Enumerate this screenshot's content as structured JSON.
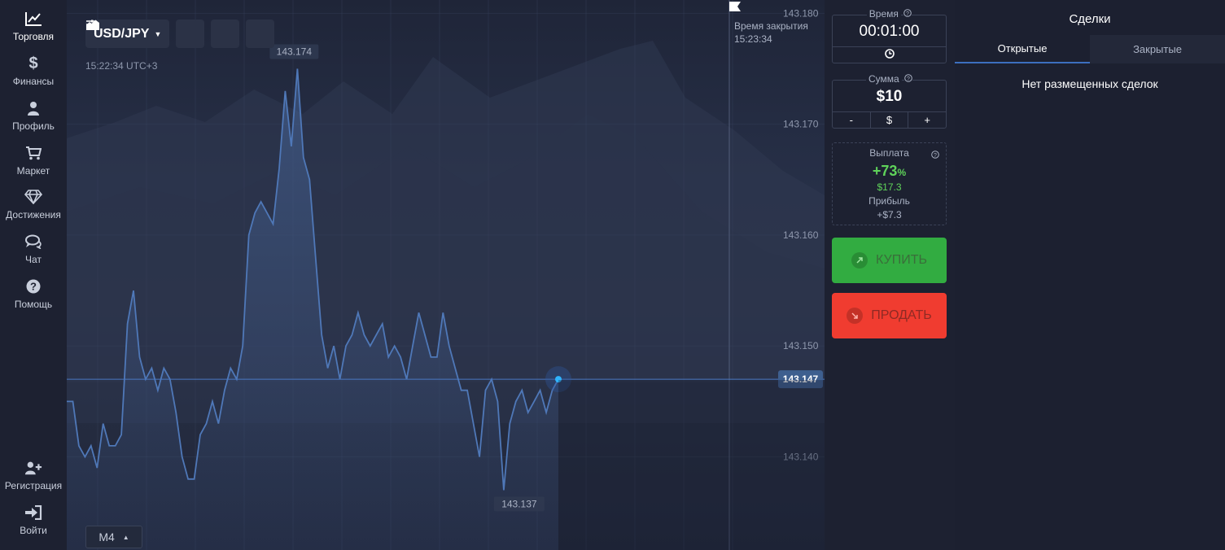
{
  "sidebar": {
    "items": [
      {
        "label": "Торговля",
        "icon": "chart-line-icon"
      },
      {
        "label": "Финансы",
        "icon": "dollar-icon"
      },
      {
        "label": "Профиль",
        "icon": "user-icon"
      },
      {
        "label": "Маркет",
        "icon": "cart-icon"
      },
      {
        "label": "Достижения",
        "icon": "diamond-icon"
      },
      {
        "label": "Чат",
        "icon": "chat-icon"
      },
      {
        "label": "Помощь",
        "icon": "help-icon"
      }
    ],
    "bottom": [
      {
        "label": "Регистрация",
        "icon": "add-user-icon"
      },
      {
        "label": "Войти",
        "icon": "sign-in-icon"
      }
    ]
  },
  "chart": {
    "pair": "USD/JPY",
    "clock": "15:22:34 UTC+3",
    "timeframe": "M4",
    "close_time_label": "Время закрытия",
    "close_time": "15:23:34",
    "max_label": "143.174",
    "min_label": "143.137",
    "current_price": "143.147",
    "line_color": "#4f78b8",
    "price_tag_color": "#3e5f8f"
  },
  "chart_data": {
    "type": "area",
    "series": [
      {
        "values": [
          143.145,
          143.145,
          143.141,
          143.14,
          143.141,
          143.139,
          143.143,
          143.141,
          143.141,
          143.142,
          143.152,
          143.155,
          143.149,
          143.147,
          143.148,
          143.146,
          143.148,
          143.147,
          143.144,
          143.14,
          143.138,
          143.138,
          143.142,
          143.143,
          143.145,
          143.143,
          143.146,
          143.148,
          143.147,
          143.15,
          143.16,
          143.162,
          143.163,
          143.162,
          143.161,
          143.166,
          143.173,
          143.168,
          143.175,
          143.167,
          143.165,
          143.158,
          143.151,
          143.148,
          143.15,
          143.147,
          143.15,
          143.151,
          143.153,
          143.151,
          143.15,
          143.151,
          143.152,
          143.149,
          143.15,
          143.149,
          143.147,
          143.15,
          143.153,
          143.151,
          143.149,
          143.149,
          143.153,
          143.15,
          143.148,
          143.146,
          143.146,
          143.143,
          143.14,
          143.146,
          143.147,
          143.145,
          143.137,
          143.143,
          143.145,
          143.146,
          143.144,
          143.145,
          143.146,
          143.144,
          143.146,
          143.147
        ]
      }
    ],
    "y_ticks": [
      "143.180",
      "143.170",
      "143.160",
      "143.150",
      "143.140"
    ],
    "ylim": [
      143.1316,
      143.1812
    ],
    "grid": true
  },
  "trade": {
    "time_label": "Время",
    "time_value": "00:01:00",
    "sum_label": "Сумма",
    "sum_value": "$10",
    "sum_buttons": [
      "-",
      "$",
      "+"
    ],
    "payout_label": "Выплата",
    "payout_percent": "+73",
    "payout_percent_sign": "%",
    "payout_amount": "$17.3",
    "profit_label": "Прибыль",
    "profit_value": "+$7.3",
    "buy_label": "КУПИТЬ",
    "sell_label": "ПРОДАТЬ",
    "buy_color": "#32ac41",
    "sell_color": "#f03c30"
  },
  "deals": {
    "title": "Сделки",
    "tabs": [
      "Открытые",
      "Закрытые"
    ],
    "empty": "Нет размещенных сделок"
  }
}
